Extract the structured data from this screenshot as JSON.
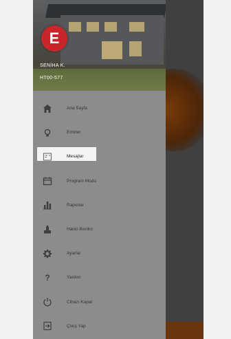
{
  "user": {
    "name": "SENİHA K.",
    "id": "HT00-577"
  },
  "logo": {
    "glyph": "E",
    "color": "#c9262b"
  },
  "menu": {
    "items": [
      {
        "label": "Ana Sayfa",
        "icon": "home-icon"
      },
      {
        "label": "Emirler",
        "icon": "lightbulb-icon"
      },
      {
        "label": "Mesajlar",
        "icon": "messages-icon",
        "active": true
      },
      {
        "label": "Program Modu",
        "icon": "calendar-icon"
      },
      {
        "label": "Raporlar",
        "icon": "chart-icon"
      },
      {
        "label": "Harici Bordro",
        "icon": "payroll-icon"
      },
      {
        "label": "Ayarlar",
        "icon": "gear-icon"
      },
      {
        "label": "Yardım",
        "icon": "help-icon"
      },
      {
        "label": "Cihazı Kapat",
        "icon": "power-icon"
      },
      {
        "label": "Çıkış Yap",
        "icon": "logout-icon"
      }
    ]
  },
  "colors": {
    "drawer": "#8c8c8c",
    "highlight": "#f4f4f4",
    "brand": "#c9262b",
    "text": "#333333"
  }
}
